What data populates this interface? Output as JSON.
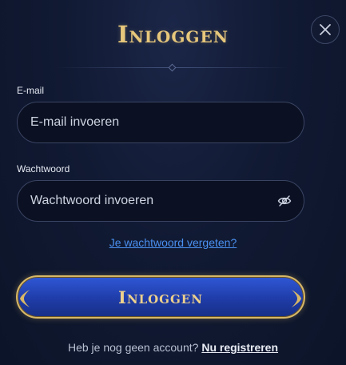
{
  "modal": {
    "title": "Inloggen",
    "close_icon": "close-icon"
  },
  "email": {
    "label": "E-mail",
    "placeholder": "E-mail invoeren",
    "value": ""
  },
  "password": {
    "label": "Wachtwoord",
    "placeholder": "Wachtwoord invoeren",
    "value": "",
    "toggle_icon": "eye-off-icon"
  },
  "forgot_password": "Je wachtwoord vergeten?",
  "login_button": "Inloggen",
  "signup": {
    "prompt": "Heb je nog geen account?",
    "link": "Nu registreren"
  },
  "colors": {
    "background": "#111a33",
    "gold": "#e7c77b",
    "link_blue": "#4a90f0",
    "button_blue": "#1f3ca8"
  }
}
